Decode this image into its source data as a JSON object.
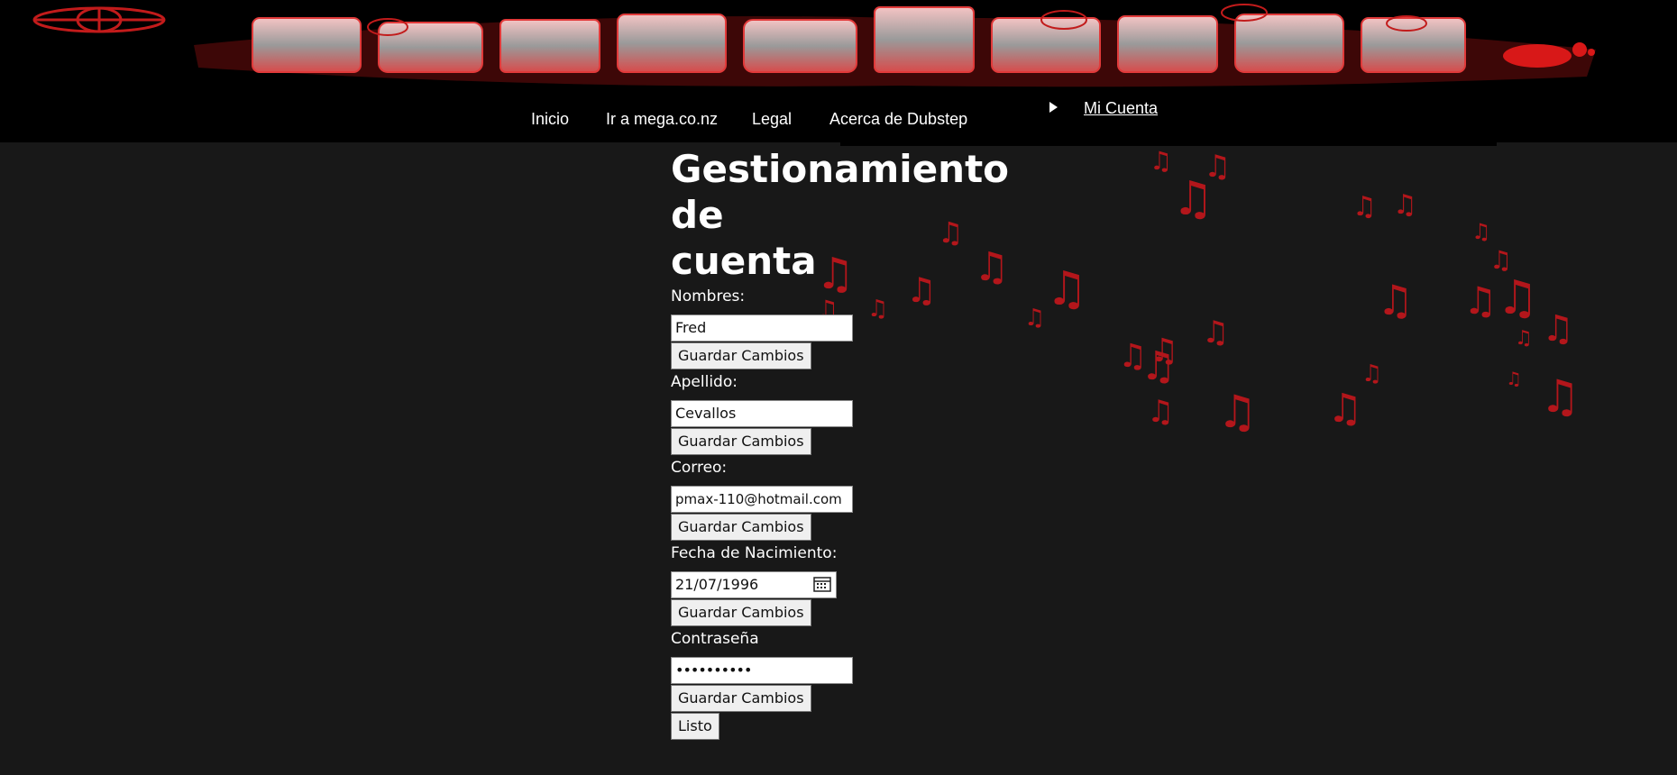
{
  "header": {
    "nav": [
      "Inicio",
      "Ir a mega.co.nz",
      "Legal",
      "Acerca de Dubstep"
    ],
    "account_link": "Mi Cuenta"
  },
  "main": {
    "title_lines": [
      "Gestionamiento",
      "de",
      "cuenta"
    ],
    "fields": [
      {
        "label": "Nombres:",
        "value": "Fred",
        "button": "Guardar Cambios"
      },
      {
        "label": "Apellido:",
        "value": " Cevallos",
        "button": "Guardar Cambios"
      },
      {
        "label": "Correo:",
        "value": " pmax-110@hotmail.com",
        "button": "Guardar Cambios"
      },
      {
        "label": "Fecha de Nacimiento:",
        "value": "21/07/1996",
        "button": "Guardar Cambios"
      },
      {
        "label": "Contraseña",
        "value": "••••••••••",
        "button": "Guardar Cambios"
      }
    ],
    "done_button": "Listo"
  },
  "icons": {
    "logo": "gothic-title-logo",
    "globe": "globe-icon",
    "calendar": "calendar-icon",
    "arrow": "play-arrow-icon",
    "notes": "music-note-icon"
  },
  "colors": {
    "background": "#181818",
    "header": "#000000",
    "accent_red": "#b3161b"
  }
}
